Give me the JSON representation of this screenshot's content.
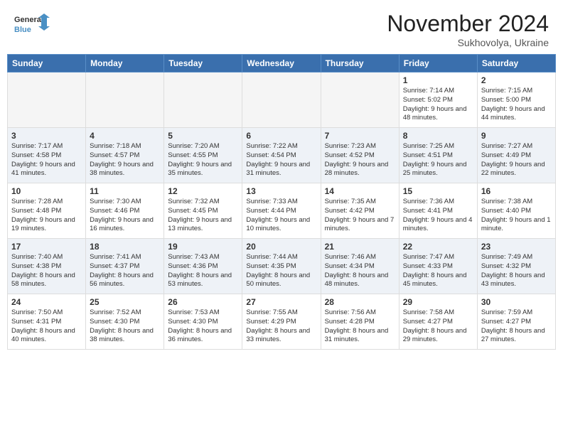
{
  "logo": {
    "text_general": "General",
    "text_blue": "Blue"
  },
  "title": "November 2024",
  "subtitle": "Sukhovolya, Ukraine",
  "days_of_week": [
    "Sunday",
    "Monday",
    "Tuesday",
    "Wednesday",
    "Thursday",
    "Friday",
    "Saturday"
  ],
  "weeks": [
    {
      "days": [
        {
          "date": "",
          "empty": true
        },
        {
          "date": "",
          "empty": true
        },
        {
          "date": "",
          "empty": true
        },
        {
          "date": "",
          "empty": true
        },
        {
          "date": "",
          "empty": true
        },
        {
          "date": "1",
          "sunrise": "Sunrise: 7:14 AM",
          "sunset": "Sunset: 5:02 PM",
          "daylight": "Daylight: 9 hours and 48 minutes."
        },
        {
          "date": "2",
          "sunrise": "Sunrise: 7:15 AM",
          "sunset": "Sunset: 5:00 PM",
          "daylight": "Daylight: 9 hours and 44 minutes."
        }
      ]
    },
    {
      "days": [
        {
          "date": "3",
          "sunrise": "Sunrise: 7:17 AM",
          "sunset": "Sunset: 4:58 PM",
          "daylight": "Daylight: 9 hours and 41 minutes."
        },
        {
          "date": "4",
          "sunrise": "Sunrise: 7:18 AM",
          "sunset": "Sunset: 4:57 PM",
          "daylight": "Daylight: 9 hours and 38 minutes."
        },
        {
          "date": "5",
          "sunrise": "Sunrise: 7:20 AM",
          "sunset": "Sunset: 4:55 PM",
          "daylight": "Daylight: 9 hours and 35 minutes."
        },
        {
          "date": "6",
          "sunrise": "Sunrise: 7:22 AM",
          "sunset": "Sunset: 4:54 PM",
          "daylight": "Daylight: 9 hours and 31 minutes."
        },
        {
          "date": "7",
          "sunrise": "Sunrise: 7:23 AM",
          "sunset": "Sunset: 4:52 PM",
          "daylight": "Daylight: 9 hours and 28 minutes."
        },
        {
          "date": "8",
          "sunrise": "Sunrise: 7:25 AM",
          "sunset": "Sunset: 4:51 PM",
          "daylight": "Daylight: 9 hours and 25 minutes."
        },
        {
          "date": "9",
          "sunrise": "Sunrise: 7:27 AM",
          "sunset": "Sunset: 4:49 PM",
          "daylight": "Daylight: 9 hours and 22 minutes."
        }
      ]
    },
    {
      "days": [
        {
          "date": "10",
          "sunrise": "Sunrise: 7:28 AM",
          "sunset": "Sunset: 4:48 PM",
          "daylight": "Daylight: 9 hours and 19 minutes."
        },
        {
          "date": "11",
          "sunrise": "Sunrise: 7:30 AM",
          "sunset": "Sunset: 4:46 PM",
          "daylight": "Daylight: 9 hours and 16 minutes."
        },
        {
          "date": "12",
          "sunrise": "Sunrise: 7:32 AM",
          "sunset": "Sunset: 4:45 PM",
          "daylight": "Daylight: 9 hours and 13 minutes."
        },
        {
          "date": "13",
          "sunrise": "Sunrise: 7:33 AM",
          "sunset": "Sunset: 4:44 PM",
          "daylight": "Daylight: 9 hours and 10 minutes."
        },
        {
          "date": "14",
          "sunrise": "Sunrise: 7:35 AM",
          "sunset": "Sunset: 4:42 PM",
          "daylight": "Daylight: 9 hours and 7 minutes."
        },
        {
          "date": "15",
          "sunrise": "Sunrise: 7:36 AM",
          "sunset": "Sunset: 4:41 PM",
          "daylight": "Daylight: 9 hours and 4 minutes."
        },
        {
          "date": "16",
          "sunrise": "Sunrise: 7:38 AM",
          "sunset": "Sunset: 4:40 PM",
          "daylight": "Daylight: 9 hours and 1 minute."
        }
      ]
    },
    {
      "days": [
        {
          "date": "17",
          "sunrise": "Sunrise: 7:40 AM",
          "sunset": "Sunset: 4:38 PM",
          "daylight": "Daylight: 8 hours and 58 minutes."
        },
        {
          "date": "18",
          "sunrise": "Sunrise: 7:41 AM",
          "sunset": "Sunset: 4:37 PM",
          "daylight": "Daylight: 8 hours and 56 minutes."
        },
        {
          "date": "19",
          "sunrise": "Sunrise: 7:43 AM",
          "sunset": "Sunset: 4:36 PM",
          "daylight": "Daylight: 8 hours and 53 minutes."
        },
        {
          "date": "20",
          "sunrise": "Sunrise: 7:44 AM",
          "sunset": "Sunset: 4:35 PM",
          "daylight": "Daylight: 8 hours and 50 minutes."
        },
        {
          "date": "21",
          "sunrise": "Sunrise: 7:46 AM",
          "sunset": "Sunset: 4:34 PM",
          "daylight": "Daylight: 8 hours and 48 minutes."
        },
        {
          "date": "22",
          "sunrise": "Sunrise: 7:47 AM",
          "sunset": "Sunset: 4:33 PM",
          "daylight": "Daylight: 8 hours and 45 minutes."
        },
        {
          "date": "23",
          "sunrise": "Sunrise: 7:49 AM",
          "sunset": "Sunset: 4:32 PM",
          "daylight": "Daylight: 8 hours and 43 minutes."
        }
      ]
    },
    {
      "days": [
        {
          "date": "24",
          "sunrise": "Sunrise: 7:50 AM",
          "sunset": "Sunset: 4:31 PM",
          "daylight": "Daylight: 8 hours and 40 minutes."
        },
        {
          "date": "25",
          "sunrise": "Sunrise: 7:52 AM",
          "sunset": "Sunset: 4:30 PM",
          "daylight": "Daylight: 8 hours and 38 minutes."
        },
        {
          "date": "26",
          "sunrise": "Sunrise: 7:53 AM",
          "sunset": "Sunset: 4:30 PM",
          "daylight": "Daylight: 8 hours and 36 minutes."
        },
        {
          "date": "27",
          "sunrise": "Sunrise: 7:55 AM",
          "sunset": "Sunset: 4:29 PM",
          "daylight": "Daylight: 8 hours and 33 minutes."
        },
        {
          "date": "28",
          "sunrise": "Sunrise: 7:56 AM",
          "sunset": "Sunset: 4:28 PM",
          "daylight": "Daylight: 8 hours and 31 minutes."
        },
        {
          "date": "29",
          "sunrise": "Sunrise: 7:58 AM",
          "sunset": "Sunset: 4:27 PM",
          "daylight": "Daylight: 8 hours and 29 minutes."
        },
        {
          "date": "30",
          "sunrise": "Sunrise: 7:59 AM",
          "sunset": "Sunset: 4:27 PM",
          "daylight": "Daylight: 8 hours and 27 minutes."
        }
      ]
    }
  ]
}
